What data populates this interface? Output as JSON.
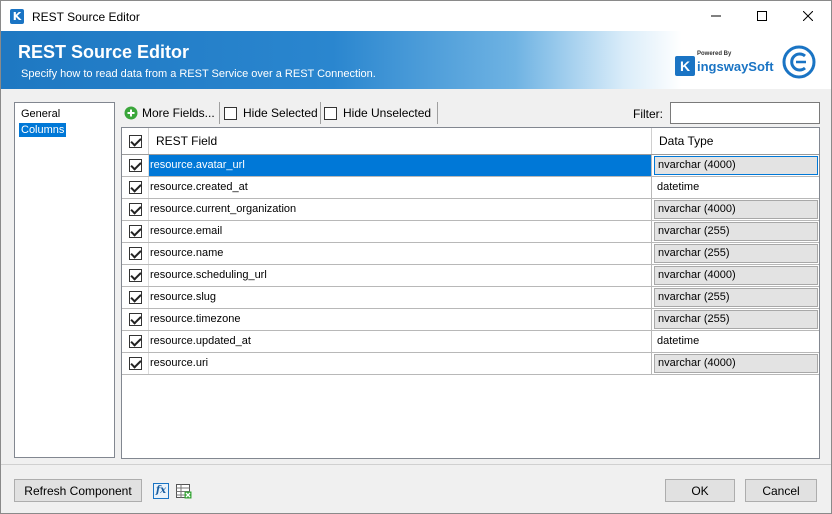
{
  "window": {
    "title": "REST Source Editor"
  },
  "banner": {
    "title": "REST Source Editor",
    "subtitle": "Specify how to read data from a REST Service over a REST Connection.",
    "logo_powered": "Powered By",
    "logo_name": "ingswaySoft"
  },
  "nav": {
    "items": [
      "General",
      "Columns"
    ],
    "selected": "Columns"
  },
  "toolbar": {
    "more_fields": "More Fields...",
    "hide_selected": "Hide Selected",
    "hide_unselected": "Hide Unselected",
    "filter_label": "Filter:",
    "filter_value": ""
  },
  "grid": {
    "headers": {
      "field": "REST Field",
      "type": "Data Type"
    },
    "rows": [
      {
        "field": "resource.avatar_url",
        "type": "nvarchar (4000)",
        "checked": true
      },
      {
        "field": "resource.created_at",
        "type": "datetime",
        "checked": true
      },
      {
        "field": "resource.current_organization",
        "type": "nvarchar (4000)",
        "checked": true
      },
      {
        "field": "resource.email",
        "type": "nvarchar (255)",
        "checked": true
      },
      {
        "field": "resource.name",
        "type": "nvarchar (255)",
        "checked": true
      },
      {
        "field": "resource.scheduling_url",
        "type": "nvarchar (4000)",
        "checked": true
      },
      {
        "field": "resource.slug",
        "type": "nvarchar (255)",
        "checked": true
      },
      {
        "field": "resource.timezone",
        "type": "nvarchar (255)",
        "checked": true
      },
      {
        "field": "resource.updated_at",
        "type": "datetime",
        "checked": true
      },
      {
        "field": "resource.uri",
        "type": "nvarchar (4000)",
        "checked": true
      }
    ]
  },
  "footer": {
    "refresh": "Refresh Component",
    "ok": "OK",
    "cancel": "Cancel"
  },
  "colors": {
    "accent": "#0078d7",
    "brand": "#1a74c4"
  }
}
